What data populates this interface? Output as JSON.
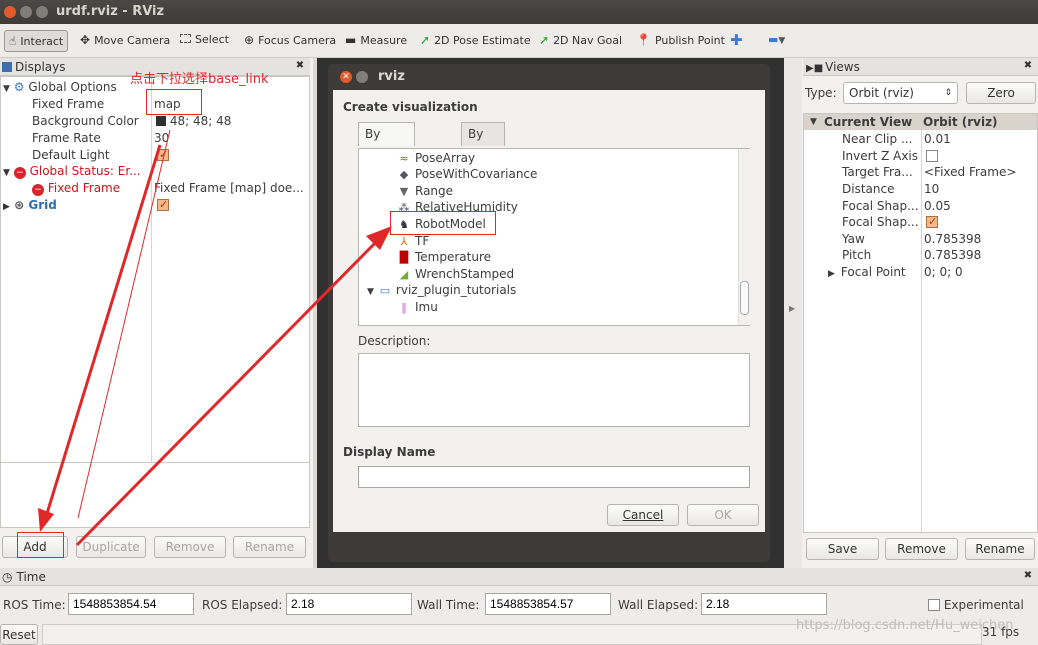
{
  "window": {
    "title": "urdf.rviz - RViz"
  },
  "toolbar": {
    "interact": "Interact",
    "move_camera": "Move Camera",
    "select": "Select",
    "focus_camera": "Focus Camera",
    "measure": "Measure",
    "pose_estimate": "2D Pose Estimate",
    "nav_goal": "2D Nav Goal",
    "publish_point": "Publish Point"
  },
  "displays": {
    "title": "Displays",
    "global_options": "Global Options",
    "fixed_frame_label": "Fixed Frame",
    "fixed_frame_value": "map",
    "bg_color_label": "Background Color",
    "bg_color_value": "48; 48; 48",
    "frame_rate_label": "Frame Rate",
    "frame_rate_value": "30",
    "default_light_label": "Default Light",
    "global_status": "Global Status: Er...",
    "fixed_frame_err_label": "Fixed Frame",
    "fixed_frame_err_value": "Fixed Frame [map] doe...",
    "grid": "Grid",
    "buttons": {
      "add": "Add",
      "duplicate": "Duplicate",
      "remove": "Remove",
      "rename": "Rename"
    }
  },
  "annotation": {
    "hint": "点击下拉选择base_link"
  },
  "dialog": {
    "title": "rviz",
    "heading": "Create visualization",
    "tab_type": "By display type",
    "tab_topic": "By topic",
    "items": {
      "pose_array": "PoseArray",
      "pose_cov": "PoseWithCovariance",
      "range": "Range",
      "humidity": "RelativeHumidity",
      "robot_model": "RobotModel",
      "tf": "TF",
      "temperature": "Temperature",
      "wrench": "WrenchStamped",
      "plugin_folder": "rviz_plugin_tutorials",
      "imu": "Imu"
    },
    "description_label": "Description:",
    "display_name_label": "Display Name",
    "display_name_value": "",
    "cancel": "Cancel",
    "ok": "OK"
  },
  "views": {
    "title": "Views",
    "type_label": "Type:",
    "type_value": "Orbit (rviz)",
    "zero": "Zero",
    "current_view": "Current View",
    "current_view_value": "Orbit (rviz)",
    "rows": [
      {
        "label": "Near Clip ...",
        "value": "0.01"
      },
      {
        "label": "Invert Z Axis",
        "value": ""
      },
      {
        "label": "Target Fra...",
        "value": "<Fixed Frame>"
      },
      {
        "label": "Distance",
        "value": "10"
      },
      {
        "label": "Focal Shap...",
        "value": "0.05"
      },
      {
        "label": "Focal Shap...",
        "value": ""
      },
      {
        "label": "Yaw",
        "value": "0.785398"
      },
      {
        "label": "Pitch",
        "value": "0.785398"
      },
      {
        "label": "Focal Point",
        "value": "0; 0; 0"
      }
    ],
    "buttons": {
      "save": "Save",
      "remove": "Remove",
      "rename": "Rename"
    }
  },
  "time": {
    "title": "Time",
    "ros_time_label": "ROS Time:",
    "ros_time_value": "1548853854.54",
    "ros_elapsed_label": "ROS Elapsed:",
    "ros_elapsed_value": "2.18",
    "wall_time_label": "Wall Time:",
    "wall_time_value": "1548853854.57",
    "wall_elapsed_label": "Wall Elapsed:",
    "wall_elapsed_value": "2.18",
    "experimental": "Experimental",
    "reset": "Reset",
    "fps": "31 fps",
    "watermark": "https://blog.csdn.net/Hu_weichen"
  },
  "colors": {
    "accent_orange": "#f07746",
    "error_red": "#e0282a",
    "grid_blue": "#2a6fb5"
  }
}
